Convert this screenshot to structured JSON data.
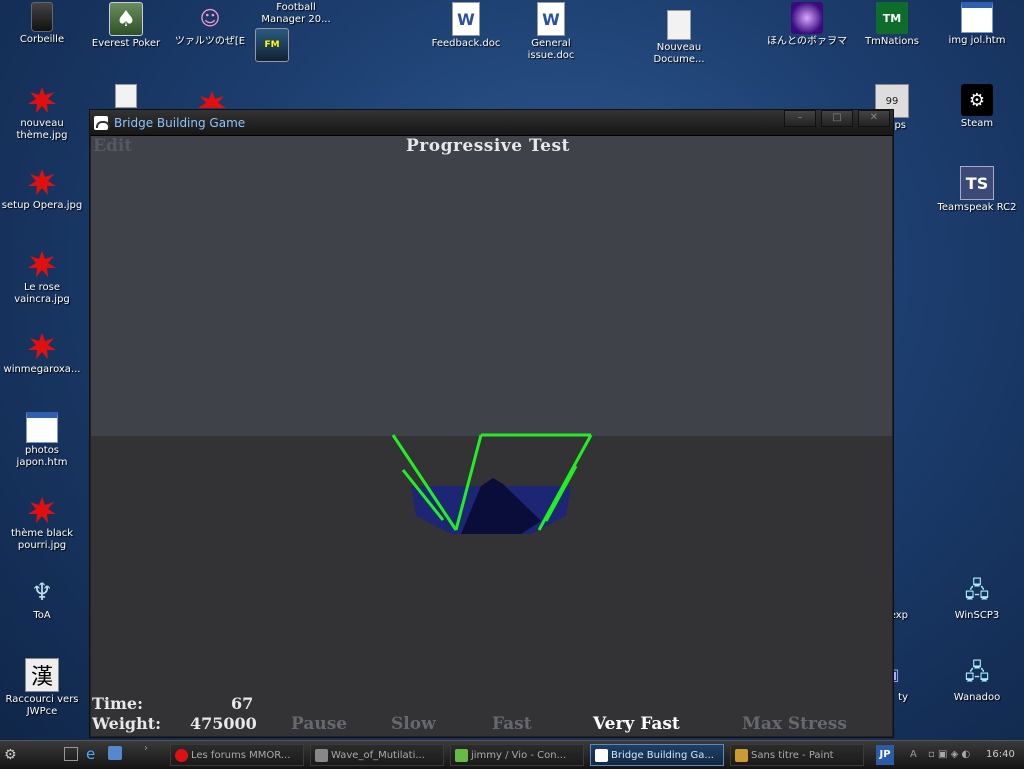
{
  "desktop": {
    "icons": [
      {
        "label": "Corbeille",
        "icon": "trash-icon"
      },
      {
        "label": "Everest Poker",
        "icon": "spade-icon"
      },
      {
        "label": "ツァルツのぜ[E",
        "icon": "character-icon"
      },
      {
        "label": "Football\nManager 20...",
        "icon": "game-icon"
      },
      {
        "label": "Feedback.doc",
        "icon": "word-doc-icon"
      },
      {
        "label": "General\nissue.doc",
        "icon": "word-doc-icon"
      },
      {
        "label": "Nouveau\nDocume...",
        "icon": "notepad-icon"
      },
      {
        "label": "ほんとのボァヲマ",
        "icon": "purple-fx-icon"
      },
      {
        "label": "TmNations",
        "icon": "tm-icon"
      },
      {
        "label": "img jol.htm",
        "icon": "html-icon"
      },
      {
        "label": "nouveau\nthème.jpg",
        "icon": "splat-icon"
      },
      {
        "label": "Steam",
        "icon": "steam-icon"
      },
      {
        "label": "setup Opera.jpg",
        "icon": "splat-icon"
      },
      {
        "label": "Teamspeak RC2",
        "icon": "teamspeak-icon"
      },
      {
        "label": "Le rose\nvaincra.jpg",
        "icon": "splat-icon"
      },
      {
        "label": "winmegaroxa...",
        "icon": "splat-icon"
      },
      {
        "label": "photos\njapon.htm",
        "icon": "html-icon"
      },
      {
        "label": "thème black\npourri.jpg",
        "icon": "splat-icon"
      },
      {
        "label": "ToA",
        "icon": "toa-icon"
      },
      {
        "label": "Raccourci vers\nJWPce",
        "icon": "kanji-icon"
      },
      {
        "label": "WinSCP3",
        "icon": "network-icon"
      },
      {
        "label": "Wanadoo",
        "icon": "network-icon"
      },
      {
        "label": "ps",
        "icon": "monitor-icon"
      },
      {
        "label": "exp",
        "icon": "app-icon"
      },
      {
        "label": "ty",
        "icon": "app-icon"
      }
    ]
  },
  "window": {
    "title": "Bridge Building Game",
    "buttons": [
      "minimize",
      "maximize",
      "close"
    ]
  },
  "game": {
    "menu_edit": "Edit",
    "level_title": "Progressive Test",
    "time_label": "Time:",
    "time_value": "67",
    "weight_label": "Weight:",
    "weight_value": "475000",
    "speed_options": [
      "Pause",
      "Slow",
      "Fast",
      "Very Fast",
      "Max Stress"
    ],
    "speed_selected": "Very Fast",
    "colors": {
      "sky": "#404249",
      "ground": "#333335",
      "bridge": "#22ee22",
      "water": "#1d2575",
      "load": "#0a0d3a"
    }
  },
  "taskbar": {
    "items": [
      {
        "label": "Les forums MMOR...",
        "icon": "opera-icon",
        "active": false
      },
      {
        "label": "Wave_of_Mutilati...",
        "icon": "media-icon",
        "active": false
      },
      {
        "label": "jimmy / Vio - Con...",
        "icon": "messenger-icon",
        "active": false
      },
      {
        "label": "Bridge Building Ga...",
        "icon": "bridge-app-icon",
        "active": true
      },
      {
        "label": "Sans titre - Paint",
        "icon": "paint-icon",
        "active": false
      }
    ],
    "language": "JP",
    "clock": "16:40"
  }
}
